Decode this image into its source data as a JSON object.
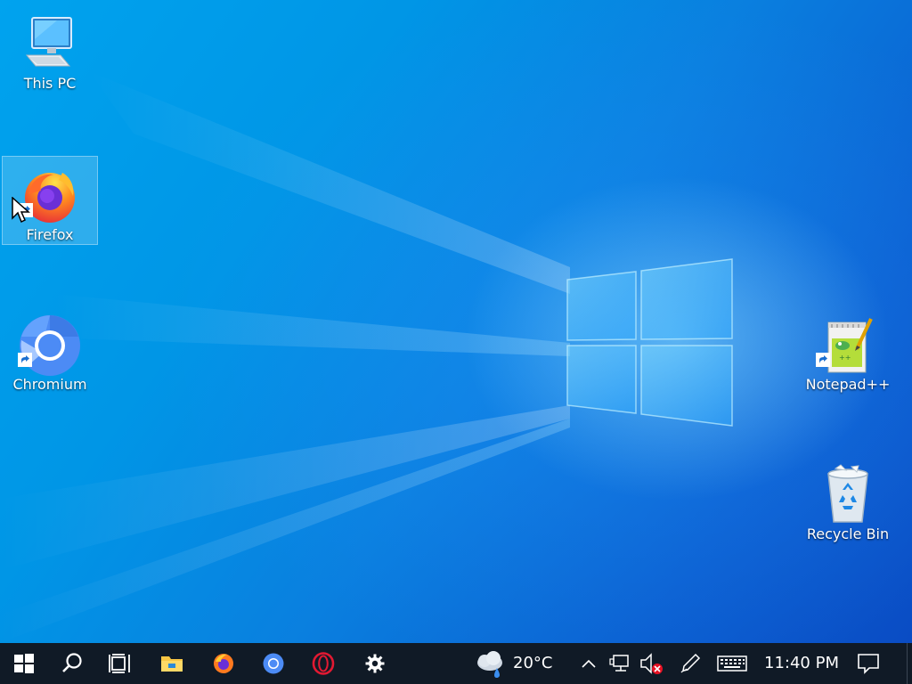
{
  "desktop": {
    "icons": [
      {
        "label": "This PC",
        "icon": "this-pc-icon"
      },
      {
        "label": "Firefox",
        "icon": "firefox-icon",
        "selected": true
      },
      {
        "label": "Chromium",
        "icon": "chromium-icon"
      },
      {
        "label": "Notepad++",
        "icon": "notepad-plus-plus-icon"
      },
      {
        "label": "Recycle Bin",
        "icon": "recycle-bin-icon"
      }
    ]
  },
  "taskbar": {
    "pinned": [
      {
        "icon": "windows-start-icon"
      },
      {
        "icon": "search-icon"
      },
      {
        "icon": "task-view-icon"
      },
      {
        "icon": "file-explorer-icon"
      },
      {
        "icon": "firefox-icon"
      },
      {
        "icon": "chromium-icon"
      },
      {
        "icon": "opera-icon"
      },
      {
        "icon": "settings-gear-icon"
      }
    ],
    "weather": {
      "icon": "cloud-rain-icon",
      "temperature": "20°C"
    },
    "tray": {
      "icons": [
        "chevron-up-icon",
        "network-icon",
        "volume-muted-icon",
        "pen-icon",
        "keyboard-icon",
        "notification-icon"
      ],
      "time": "11:40 PM"
    }
  },
  "colors": {
    "taskbar": "#101a26",
    "desktop_accent": "#0a7fdf"
  }
}
